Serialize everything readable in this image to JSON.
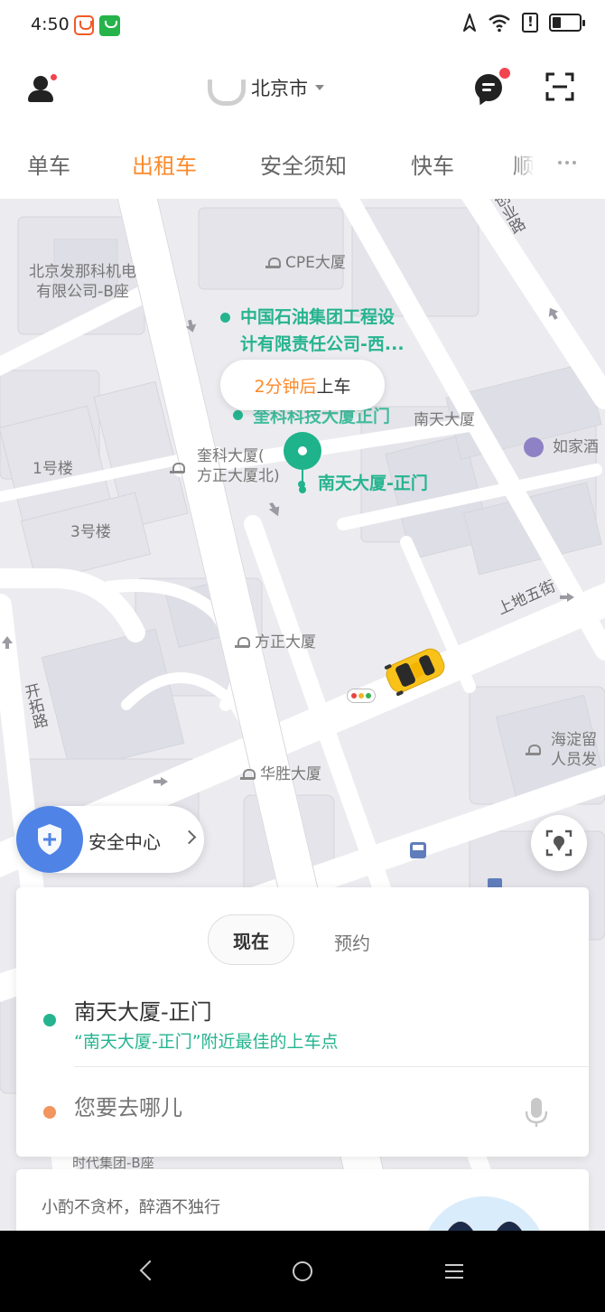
{
  "status_bar": {
    "time": "4:50"
  },
  "header": {
    "city": "北京市"
  },
  "tabs": [
    "单车",
    "出租车",
    "安全须知",
    "快车",
    "顺"
  ],
  "map": {
    "eta_bubble": {
      "eta": "2分钟后",
      "suffix": "上车"
    },
    "pois": {
      "cpe": "CPE大厦",
      "beijing_faner": "北京发那科机电\n有限公司-B座",
      "petro_line1": "中国石油集团工程设",
      "petro_line2": "计有限责任公司-西...",
      "kuike_gate": "奎科科技大厦正门",
      "nantian_tower": "南天大厦",
      "rujia": "如家酒",
      "kuike_building_line1": "奎科大厦(",
      "kuike_building_line2": "方正大厦北)",
      "nantian_gate": "南天大厦-正门",
      "building1": "1号楼",
      "building3": "3号楼",
      "fangzheng": "方正大厦",
      "huasheng": "华胜大厦",
      "haidian_line1": "海淀留",
      "haidian_line2": "人员发",
      "shidai": "时代集团-B座"
    },
    "roads": {
      "shangdi_5th": "上地五街",
      "kaituo": "开拓路",
      "chuangye": "创业路"
    }
  },
  "safety_center": {
    "label": "安全中心"
  },
  "booking": {
    "mode_now": "现在",
    "mode_reserve": "预约",
    "pickup_name": "南天大厦-正门",
    "pickup_hint": "“南天大厦-正门”附近最佳的上车点",
    "destination_placeholder": "您要去哪儿"
  },
  "promo": {
    "text": "小酌不贪杯，醉酒不独行"
  },
  "colors": {
    "accent_orange": "#fc8a2b",
    "pickup_green": "#25b48f",
    "destination_orange": "#f2955e",
    "safety_blue": "#4f84e6",
    "badge_red": "#f3434f"
  },
  "icons": {
    "status_left": [
      "didi-app-icon",
      "shopping-bag-icon"
    ],
    "status_right": [
      "navigation-icon",
      "wifi-icon",
      "alert-icon",
      "battery-icon"
    ],
    "header": [
      "user-avatar-icon",
      "didi-logo-icon",
      "message-icon",
      "scan-icon"
    ],
    "map": [
      "pickup-pin-icon",
      "taxi-car-icon",
      "traffic-light-icon",
      "shield-plus-icon",
      "locate-icon",
      "bus-stop-icon",
      "hotel-moon-icon"
    ],
    "nav": [
      "back-icon",
      "home-icon",
      "menu-icon"
    ]
  }
}
